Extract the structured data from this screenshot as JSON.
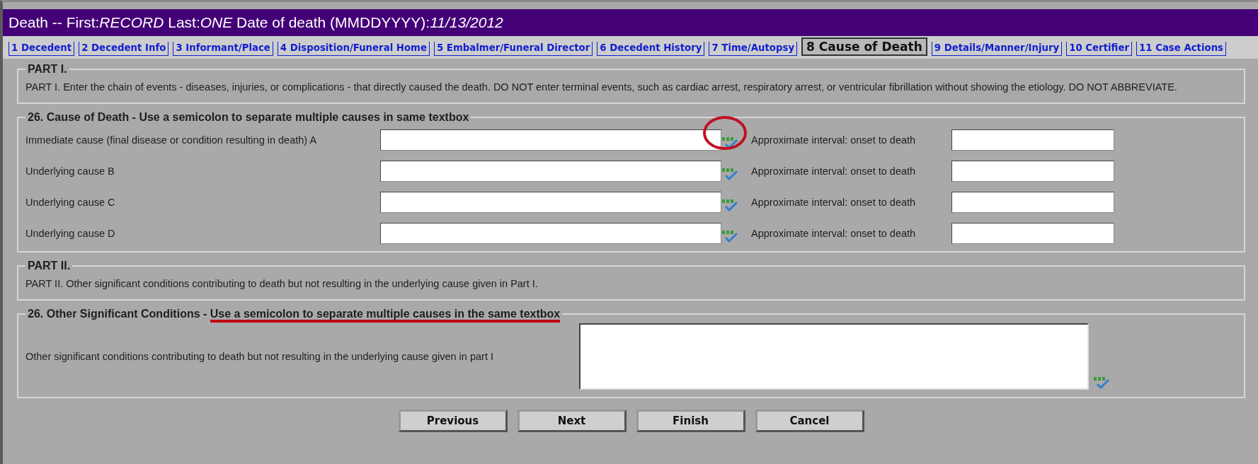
{
  "window": {
    "title": "Death -- First:*RECORD* Last:*ONE* Date of death (MMDDYYYY):*11/13/2012*"
  },
  "tabs": [
    {
      "label": "1 Decedent",
      "selected": false
    },
    {
      "label": "2 Decedent Info",
      "selected": false
    },
    {
      "label": "3 Informant/Place",
      "selected": false
    },
    {
      "label": "4 Disposition/Funeral Home",
      "selected": false
    },
    {
      "label": "5 Embalmer/Funeral Director",
      "selected": false
    },
    {
      "label": "6 Decedent History",
      "selected": false
    },
    {
      "label": "7 Time/Autopsy",
      "selected": false
    },
    {
      "label": "8 Cause of Death",
      "selected": true
    },
    {
      "label": "9 Details/Manner/Injury",
      "selected": false
    },
    {
      "label": "10 Certifier",
      "selected": false
    },
    {
      "label": "11 Case Actions",
      "selected": false
    }
  ],
  "part1": {
    "legend": "PART I.",
    "text": "PART I. Enter the chain of events - diseases, injuries, or complications - that directly caused the death. DO NOT enter terminal events, such as cardiac arrest, respiratory arrest, or ventricular fibrillation without showing the etiology. DO NOT ABBREVIATE."
  },
  "cause_of_death": {
    "legend": "26. Cause of Death - Use a semicolon to separate multiple causes in same textbox",
    "rows": [
      {
        "label": "Immediate cause (final disease or condition resulting in death) A",
        "interval_label": "Approximate interval: onset to death",
        "circled": true
      },
      {
        "label": "Underlying cause B",
        "interval_label": "Approximate interval: onset to death",
        "circled": false
      },
      {
        "label": "Underlying cause C",
        "interval_label": "Approximate interval: onset to death",
        "circled": false
      },
      {
        "label": "Underlying cause D",
        "interval_label": "Approximate interval: onset to death",
        "circled": false
      }
    ]
  },
  "part2": {
    "legend": "PART II.",
    "text": "PART II. Other significant conditions contributing to death but not resulting in the underlying cause given in Part I."
  },
  "other_conditions": {
    "legend": "26. Other Significant Conditions - ",
    "legend_note": "Use a semicolon to separate multiple causes in the same textbox",
    "note_underlined": true,
    "label": "Other significant conditions contributing to death but not resulting in the underlying cause given in part I"
  },
  "buttons": [
    "Previous",
    "Next",
    "Finish",
    "Cancel"
  ]
}
